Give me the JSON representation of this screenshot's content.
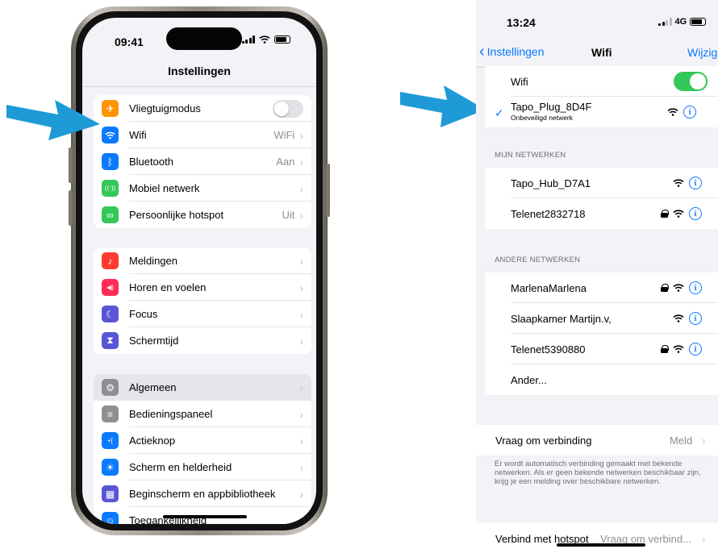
{
  "left_phone": {
    "time": "09:41",
    "title": "Instellingen",
    "groups": [
      [
        {
          "label": "Vliegtuigmodus",
          "value": "",
          "icon": "airplane-icon",
          "color": "#ff9500",
          "control": "toggle-off"
        },
        {
          "label": "Wifi",
          "value": "WiFi",
          "icon": "wifi-icon",
          "color": "#0a7aff"
        },
        {
          "label": "Bluetooth",
          "value": "Aan",
          "icon": "bluetooth-icon",
          "color": "#0a7aff"
        },
        {
          "label": "Mobiel netwerk",
          "value": "",
          "icon": "antenna-icon",
          "color": "#34c759"
        },
        {
          "label": "Persoonlijke hotspot",
          "value": "Uit",
          "icon": "hotspot-icon",
          "color": "#34c759"
        }
      ],
      [
        {
          "label": "Meldingen",
          "value": "",
          "icon": "bell-icon",
          "color": "#ff3b30"
        },
        {
          "label": "Horen en voelen",
          "value": "",
          "icon": "speaker-icon",
          "color": "#ff2d55"
        },
        {
          "label": "Focus",
          "value": "",
          "icon": "moon-icon",
          "color": "#5856d6"
        },
        {
          "label": "Schermtijd",
          "value": "",
          "icon": "hourglass-icon",
          "color": "#5856d6"
        }
      ],
      [
        {
          "label": "Algemeen",
          "value": "",
          "icon": "gear-icon",
          "color": "#8e8e93",
          "highlight": true
        },
        {
          "label": "Bedieningspaneel",
          "value": "",
          "icon": "switches-icon",
          "color": "#8e8e93"
        },
        {
          "label": "Actieknop",
          "value": "",
          "icon": "action-button-icon",
          "color": "#0a7aff"
        },
        {
          "label": "Scherm en helderheid",
          "value": "",
          "icon": "sun-icon",
          "color": "#0a7aff"
        },
        {
          "label": "Beginscherm en appbibliotheek",
          "value": "",
          "icon": "grid-icon",
          "color": "#5856d6"
        },
        {
          "label": "Toegankelijkheid",
          "value": "",
          "icon": "accessibility-icon",
          "color": "#0a7aff"
        }
      ]
    ]
  },
  "right_phone": {
    "time": "13:24",
    "network": "4G",
    "back_label": "Instellingen",
    "title": "Wifi",
    "edit_label": "Wijzig",
    "wifi_label": "Wifi",
    "connected": {
      "name": "Tapo_Plug_8D4F",
      "subtitle": "Onbeveiligd netwerk"
    },
    "my_networks_header": "MIJN NETWERKEN",
    "my_networks": [
      {
        "name": "Tapo_Hub_D7A1",
        "locked": false
      },
      {
        "name": "Telenet2832718",
        "locked": true
      }
    ],
    "other_networks_header": "ANDERE NETWERKEN",
    "other_networks": [
      {
        "name": "MarlenaMarlena",
        "locked": true
      },
      {
        "name": "Slaapkamer Martijn.v,",
        "locked": false
      },
      {
        "name": "Telenet5390880",
        "locked": true
      }
    ],
    "other_label": "Ander...",
    "ask_join_label": "Vraag om verbinding",
    "ask_join_value": "Meld",
    "ask_join_footer": "Er wordt automatisch verbinding gemaakt met bekende netwerken. Als er geen bekende netwerken beschikbaar zijn, krijg je een melding over beschikbare netwerken.",
    "hotspot_label": "Verbind met hotspot",
    "hotspot_value": "Vraag om verbind..."
  },
  "colors": {
    "accent": "#0a78ff",
    "toggle_on": "#34c759",
    "arrow": "#1e9bd7"
  }
}
